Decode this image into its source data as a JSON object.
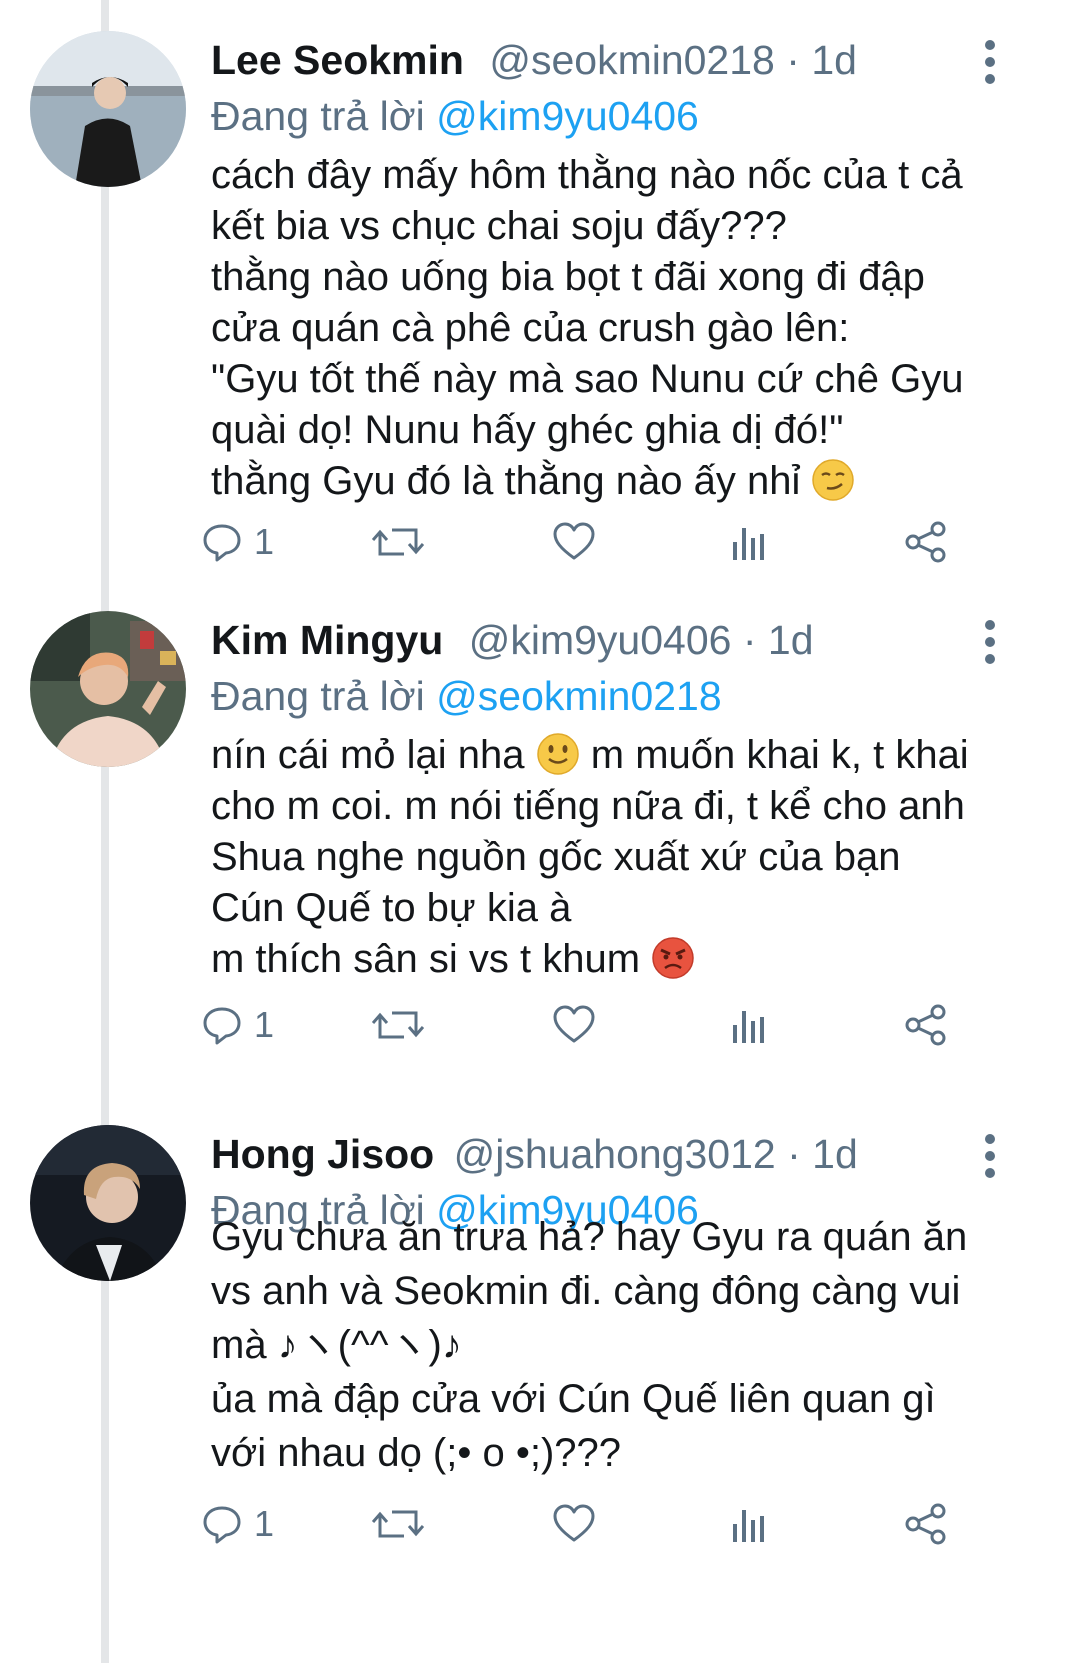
{
  "tweets": [
    {
      "name": "Lee Seokmin",
      "handle": "@seokmin0218",
      "dot": "·",
      "time": "1d",
      "replying_label": "Đang trả lời",
      "replying_to": "@kim9yu0406",
      "lines": [
        "cách đây mấy hôm thằng nào nốc của t cả",
        "kết bia vs chục chai soju đấy???",
        "thằng nào uống bia bọt t đãi xong đi đập",
        "cửa quán cà phê của crush gào lên:",
        "\"Gyu tốt thế này mà sao Nunu cứ chê Gyu",
        "quài dọ! Nunu hấy ghéc ghia dị đó!\"",
        "thằng Gyu đó là thằng nào ấy nhỉ"
      ],
      "reply_count": "1"
    },
    {
      "name": "Kim Mingyu",
      "handle": "@kim9yu0406",
      "dot": "·",
      "time": "1d",
      "replying_label": "Đang trả lời",
      "replying_to": "@seokmin0218",
      "lines_a": "nín cái mỏ lại nha",
      "lines_b": "m muốn khai k, t khai",
      "lines": [
        "cho m coi. m nói tiếng nữa đi, t kể cho anh",
        "Shua nghe nguồn gốc xuất xứ của bạn",
        "Cún Quế to bự kia à",
        "m thích sân si vs t khum"
      ],
      "reply_count": "1"
    },
    {
      "name": "Hong Jisoo",
      "handle": "@jshuahong3012",
      "dot": "·",
      "time": "1d",
      "replying_label": "Đang trả lời",
      "replying_to": "@kim9yu0406",
      "lines": [
        "Gyu chưa ăn trưa hả? hay Gyu ra quán ăn",
        "vs anh và Seokmin đi. càng đông càng vui",
        "mà ♪ヽ(^^ヽ)♪",
        "ủa mà đập cửa với Cún Quế liên quan gì",
        "với nhau dọ (;• o •;)???"
      ],
      "reply_count": "1"
    }
  ],
  "icons": {
    "reply": "reply-icon",
    "retweet": "retweet-icon",
    "like": "heart-icon",
    "stats": "analytics-icon",
    "share": "share-icon",
    "more": "more-vertical-icon"
  },
  "colors": {
    "text": "#14171a",
    "secondary": "#5b7083",
    "link": "#1da1f2",
    "thread_line": "#e4e6e8"
  }
}
